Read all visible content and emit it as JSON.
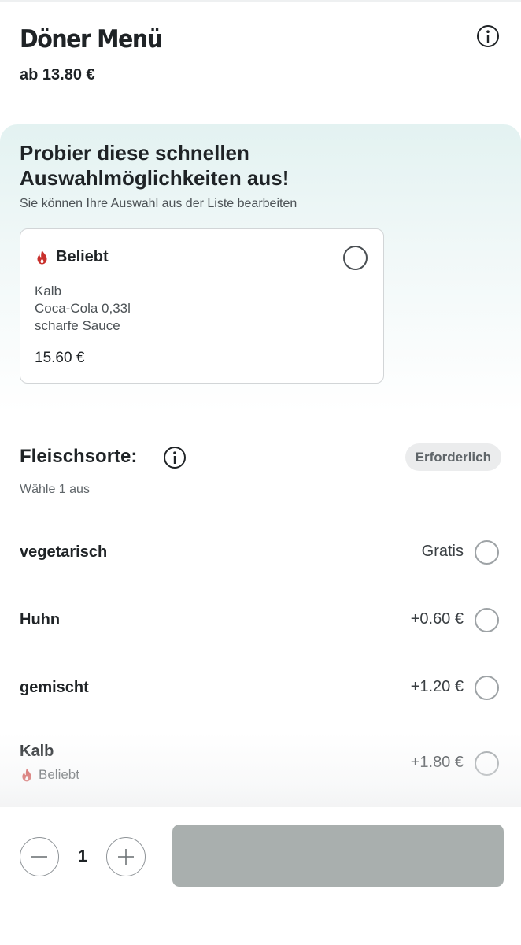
{
  "header": {
    "title": "Döner Menü",
    "base_price": "ab 13.80 €",
    "info_icon": "info-icon"
  },
  "quick_picks": {
    "title": "Probier diese schnellen Auswahlmöglichkeiten aus!",
    "subtitle": "Sie können Ihre Auswahl aus der Liste bearbeiten",
    "combo": {
      "badge_icon": "flame-icon",
      "badge_label": "Beliebt",
      "items": [
        "Kalb",
        "Coca-Cola 0,33l",
        "scharfe Sauce"
      ],
      "price": "15.60 €"
    }
  },
  "group": {
    "title": "Fleischsorte:",
    "required_label": "Erforderlich",
    "hint": "Wähle 1 aus",
    "options": [
      {
        "label": "vegetarisch",
        "price": "Gratis"
      },
      {
        "label": "Huhn",
        "price": "+0.60 €"
      },
      {
        "label": "gemischt",
        "price": "+1.20 €"
      },
      {
        "label": "Kalb",
        "price": "+1.80 €",
        "tag": "Beliebt"
      }
    ]
  },
  "footer": {
    "quantity": "1",
    "minus_icon": "minus-icon",
    "plus_icon": "plus-icon"
  },
  "colors": {
    "accent_flame": "#c9302c",
    "text": "#1f2326",
    "add_button_disabled": "#a9afae",
    "quick_bg": "#e3f2f1"
  }
}
